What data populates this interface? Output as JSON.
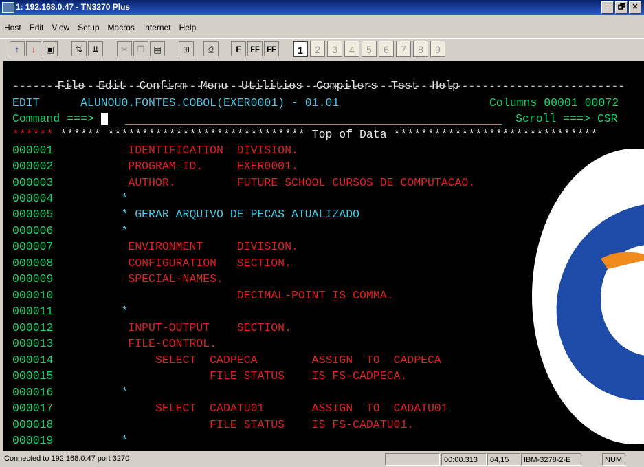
{
  "window": {
    "title": "1: 192.168.0.47 - TN3270 Plus",
    "buttons": [
      "_",
      "🗗",
      "✕"
    ]
  },
  "menubar": [
    "Host",
    "Edit",
    "View",
    "Setup",
    "Macros",
    "Internet",
    "Help"
  ],
  "toolbar": {
    "font_buttons": [
      "F",
      "FF",
      "FF"
    ],
    "session_tabs": [
      "1",
      "2",
      "3",
      "4",
      "5",
      "6",
      "7",
      "8",
      "9"
    ],
    "active_session": "1"
  },
  "terminal": {
    "menu": [
      "File",
      "Edit",
      "Confirm",
      "Menu",
      "Utilities",
      "Compilers",
      "Test",
      "Help"
    ],
    "divider": "------------------------------------------------------------------------------------------",
    "header": {
      "mode": "EDIT",
      "dataset": "ALUNOU0.FONTES.COBOL(EXER0001) - 01.01",
      "columns": "Columns 00001 00072"
    },
    "command": {
      "prompt": "Command ===>",
      "scroll": "Scroll ===> CSR"
    },
    "top_of_data": "****** ***************************** Top of Data ******************************",
    "lines": [
      {
        "num": "000001",
        "text": "           IDENTIFICATION  DIVISION."
      },
      {
        "num": "000002",
        "text": "           PROGRAM-ID.     EXER0001."
      },
      {
        "num": "000003",
        "text": "           AUTHOR.         FUTURE SCHOOL CURSOS DE COMPUTACAO."
      },
      {
        "num": "000004",
        "text": "          *"
      },
      {
        "num": "000005",
        "text": "          * GERAR ARQUIVO DE PECAS ATUALIZADO"
      },
      {
        "num": "000006",
        "text": "          *"
      },
      {
        "num": "000007",
        "text": "           ENVIRONMENT     DIVISION."
      },
      {
        "num": "000008",
        "text": "           CONFIGURATION   SECTION."
      },
      {
        "num": "000009",
        "text": "           SPECIAL-NAMES."
      },
      {
        "num": "000010",
        "text": "                           DECIMAL-POINT IS COMMA."
      },
      {
        "num": "000011",
        "text": "          *"
      },
      {
        "num": "000012",
        "text": "           INPUT-OUTPUT    SECTION."
      },
      {
        "num": "000013",
        "text": "           FILE-CONTROL."
      },
      {
        "num": "000014",
        "text": "               SELECT  CADPECA        ASSIGN  TO  CADPECA"
      },
      {
        "num": "000015",
        "text": "                       FILE STATUS    IS FS-CADPECA."
      },
      {
        "num": "000016",
        "text": "          *"
      },
      {
        "num": "000017",
        "text": "               SELECT  CADATU01       ASSIGN  TO  CADATU01"
      },
      {
        "num": "000018",
        "text": "                       FILE STATUS    IS FS-CADATU01."
      },
      {
        "num": "000019",
        "text": "          *"
      }
    ]
  },
  "statusbar": {
    "connection": "Connected to 192.168.0.47 port 3270",
    "timer": "00:00.313",
    "cursor_pos": "04,15",
    "terminal_type": "IBM-3278-2-E",
    "num": "NUM"
  },
  "colors": {
    "terminal_bg": "#000000",
    "green": "#11d56e",
    "red": "#e21e1e",
    "cyan": "#47c8e2",
    "logo_blue": "#1e4aa8",
    "logo_orange": "#f08a1c"
  }
}
